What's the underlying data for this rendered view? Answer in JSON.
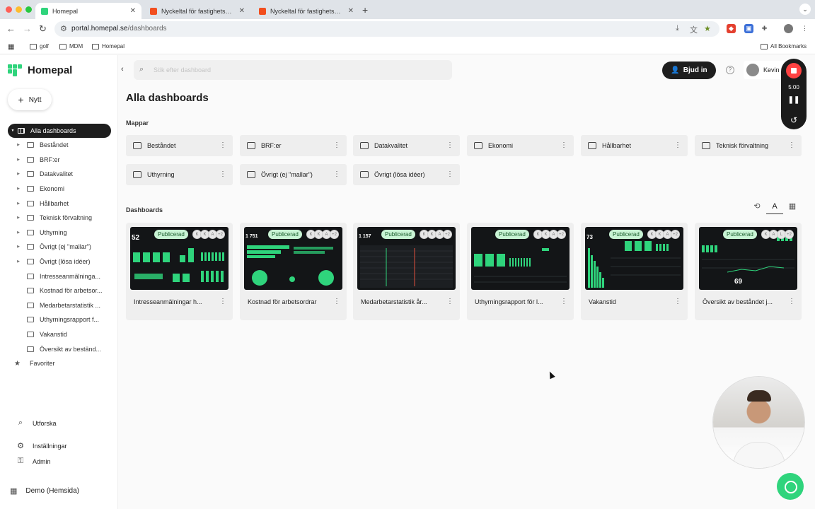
{
  "browser": {
    "tabs": [
      {
        "label": "Homepal",
        "active": true,
        "favicon_color": "#2fd47c"
      },
      {
        "label": "Nyckeltal för fastighetsbolag",
        "active": false,
        "favicon_color": "#f24e1e"
      },
      {
        "label": "Nyckeltal för fastighetsbolag",
        "active": false,
        "favicon_color": "#f24e1e"
      }
    ],
    "url_domain": "portal.homepal.se",
    "url_path": "/dashboards",
    "bookmarks": [
      "golf",
      "MDM",
      "Homepal"
    ],
    "all_bookmarks": "All Bookmarks"
  },
  "app": {
    "brand": "Homepal",
    "accent": "#2fd47c",
    "new_button": "Nytt",
    "search_placeholder": "Sök efter dashboard",
    "invite_label": "Bjud in",
    "user_name": "Kevin I"
  },
  "sidebar": {
    "items": [
      {
        "label": "Alla dashboards",
        "active": true,
        "icon": "grid-icon",
        "caret": true
      },
      {
        "label": "Beståndet",
        "icon": "folder-icon",
        "caret": true
      },
      {
        "label": "BRF:er",
        "icon": "folder-icon",
        "caret": true
      },
      {
        "label": "Datakvalitet",
        "icon": "folder-icon",
        "caret": true
      },
      {
        "label": "Ekonomi",
        "icon": "folder-icon",
        "caret": true
      },
      {
        "label": "Hållbarhet",
        "icon": "folder-icon",
        "caret": true
      },
      {
        "label": "Teknisk förvaltning",
        "icon": "folder-icon",
        "caret": true
      },
      {
        "label": "Uthyrning",
        "icon": "folder-icon",
        "caret": true
      },
      {
        "label": "Övrigt (ej \"mallar\")",
        "icon": "folder-icon",
        "caret": true
      },
      {
        "label": "Övrigt (lösa idéer)",
        "icon": "folder-icon",
        "caret": true
      },
      {
        "label": "Intresseanmälninga...",
        "icon": "dashboard-icon",
        "caret": false
      },
      {
        "label": "Kostnad för arbetsor...",
        "icon": "dashboard-icon",
        "caret": false
      },
      {
        "label": "Medarbetarstatistik ...",
        "icon": "dashboard-icon",
        "caret": false
      },
      {
        "label": "Uthyrningsrapport f...",
        "icon": "dashboard-icon",
        "caret": false
      },
      {
        "label": "Vakanstid",
        "icon": "dashboard-icon",
        "caret": false
      },
      {
        "label": "Översikt av beständ...",
        "icon": "dashboard-icon",
        "caret": false
      }
    ],
    "favorites": "Favoriter",
    "explore": "Utforska",
    "settings": "Inställningar",
    "admin": "Admin",
    "org": "Demo (Hemsida)"
  },
  "main": {
    "title": "Alla dashboards",
    "folders_heading": "Mappar",
    "folders": [
      "Beståndet",
      "BRF:er",
      "Datakvalitet",
      "Ekonomi",
      "Hållbarhet",
      "Teknisk förvaltning",
      "Uthyrning",
      "Övrigt (ej \"mallar\")",
      "Övrigt (lösa idéer)"
    ],
    "dashboards_heading": "Dashboards",
    "dashboards": [
      {
        "title": "Intresseanmälningar h...",
        "badge": "Publicerad",
        "avatars": [
          "K",
          "K",
          "A",
          "+2"
        ],
        "thumb_number": "52"
      },
      {
        "title": "Kostnad för arbetsordrar",
        "badge": "Publicerad",
        "avatars": [
          "K",
          "K",
          "A",
          "+2"
        ],
        "thumb_number": "1 751"
      },
      {
        "title": "Medarbetarstatistik år...",
        "badge": "Publicerad",
        "avatars": [
          "K",
          "K",
          "A",
          "+2"
        ],
        "thumb_number": "1 157"
      },
      {
        "title": "Uthyrningsrapport för l...",
        "badge": "Publicerad",
        "avatars": [
          "K",
          "K",
          "A",
          "+2"
        ],
        "thumb_number": ""
      },
      {
        "title": "Vakanstid",
        "badge": "Publicerad",
        "avatars": [
          "K",
          "K",
          "A",
          "+2"
        ],
        "thumb_number": "73"
      },
      {
        "title": "Översikt av beståndet j...",
        "badge": "Publicerad",
        "avatars": [
          "K",
          "A",
          "L",
          "+2"
        ],
        "thumb_number": "69"
      }
    ]
  },
  "recorder": {
    "time": "5:00"
  }
}
